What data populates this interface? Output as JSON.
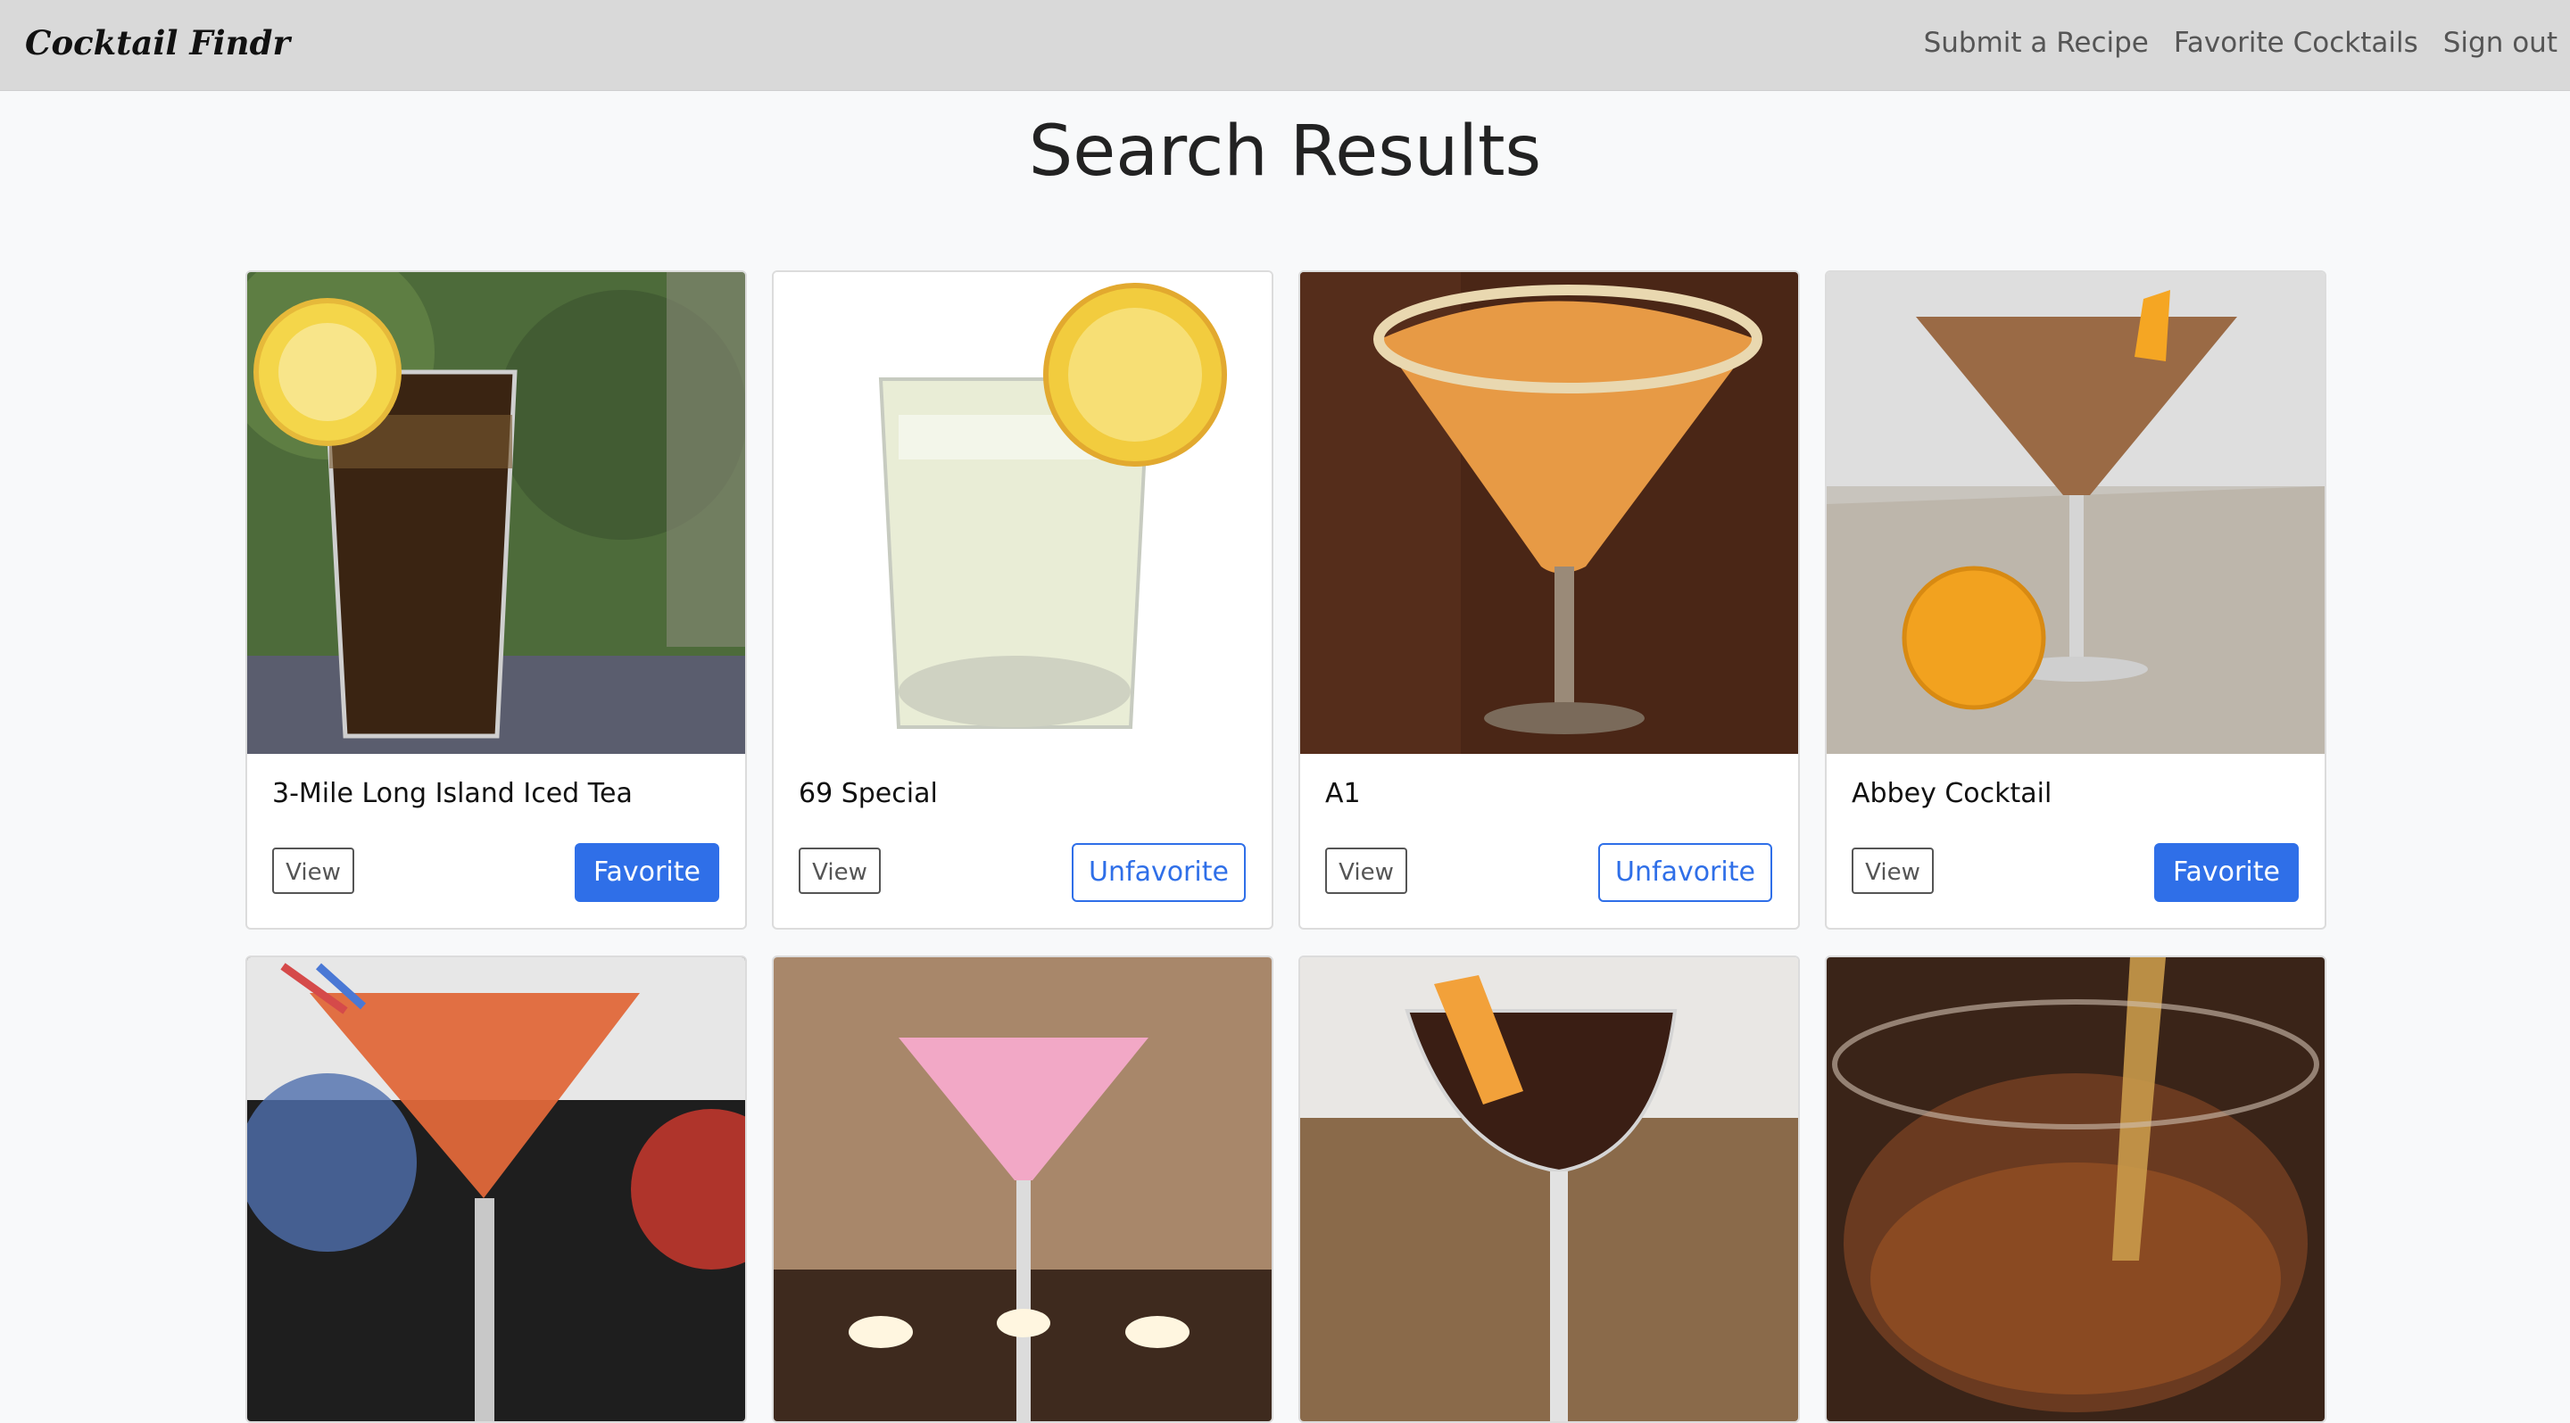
{
  "nav": {
    "brand": "Cocktail Findr",
    "links": [
      "Submit a Recipe",
      "Favorite Cocktails",
      "Sign out"
    ]
  },
  "page": {
    "title": "Search Results"
  },
  "cards": [
    {
      "title": "3-Mile Long Island Iced Tea",
      "view": "View",
      "action": "Favorite",
      "image": "iced-tea-glass-with-lemon"
    },
    {
      "title": "69 Special",
      "view": "View",
      "action": "Unfavorite",
      "image": "rocks-glass-with-lemon"
    },
    {
      "title": "A1",
      "view": "View",
      "action": "Unfavorite",
      "image": "sugar-rim-martini-orange"
    },
    {
      "title": "Abbey Cocktail",
      "view": "View",
      "action": "Favorite",
      "image": "martini-with-orange-on-wood"
    },
    {
      "title": "",
      "image": "orange-martini-with-straws"
    },
    {
      "title": "",
      "image": "pink-martini-with-candles"
    },
    {
      "title": "",
      "image": "coupe-with-orange-peel"
    },
    {
      "title": "",
      "image": "pouring-brown-drink"
    }
  ],
  "colors": {
    "primary": "#2f6fe8",
    "navbar": "#d9d9d9",
    "background": "#f8f9fa"
  }
}
